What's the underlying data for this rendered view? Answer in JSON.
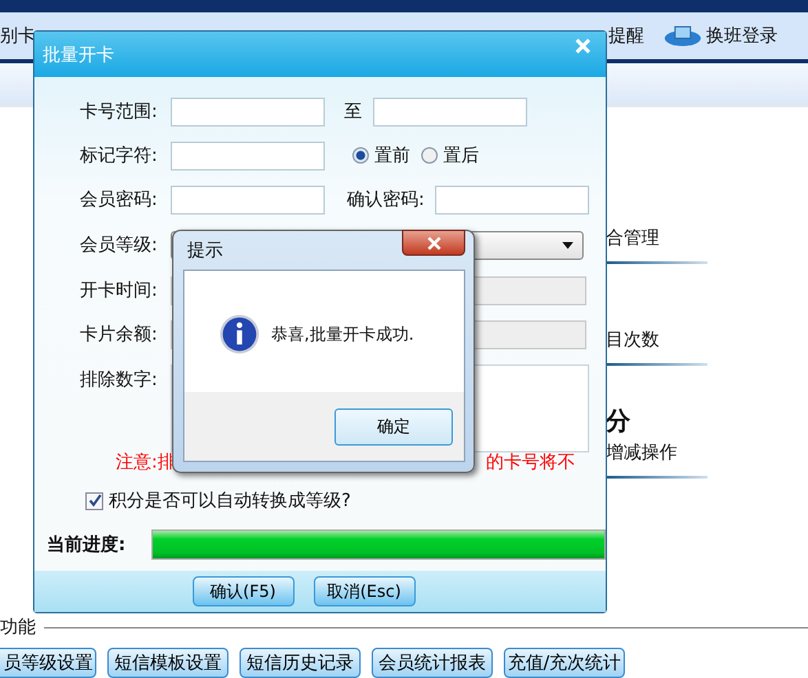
{
  "app": {
    "toolbar": [
      {
        "label": "别卡"
      },
      {
        "label": "提醒"
      },
      {
        "label": "换班登录"
      }
    ],
    "panels": [
      {
        "title": "合管理"
      },
      {
        "title": "目次数"
      },
      {
        "title": "分",
        "subtitle": "增减操作"
      }
    ],
    "section": {
      "title": "功能",
      "buttons": [
        "员等级设置",
        "短信模板设置",
        "短信历史记录",
        "会员统计报表",
        "充值/充次统计"
      ]
    }
  },
  "dialog": {
    "title": "批量开卡",
    "rows": [
      {
        "kind": "range",
        "label": "卡号范围:",
        "separator": "至"
      },
      {
        "kind": "radio",
        "label": "标记字符:",
        "options": [
          {
            "label": "置前",
            "selected": true
          },
          {
            "label": "置后",
            "selected": false
          }
        ]
      },
      {
        "kind": "password",
        "label": "会员密码:",
        "label_2": "确认密码:"
      },
      {
        "kind": "select",
        "label": "会员等级:"
      },
      {
        "kind": "text",
        "label": "开卡时间:"
      },
      {
        "kind": "text",
        "label": "卡片余额:"
      },
      {
        "kind": "textarea",
        "label": "排除数字:"
      }
    ],
    "note": [
      "注意:排",
      "的卡号将不"
    ],
    "auto_level": {
      "label": "积分是否可以自动转换成等级?",
      "checked": true
    },
    "progress": {
      "label": "当前进度:",
      "level": 1
    },
    "buttons": [
      "确认(F5)",
      "取消(Esc)"
    ]
  },
  "message": {
    "title": "提示",
    "text": "恭喜,批量开卡成功.",
    "button": "确定"
  }
}
